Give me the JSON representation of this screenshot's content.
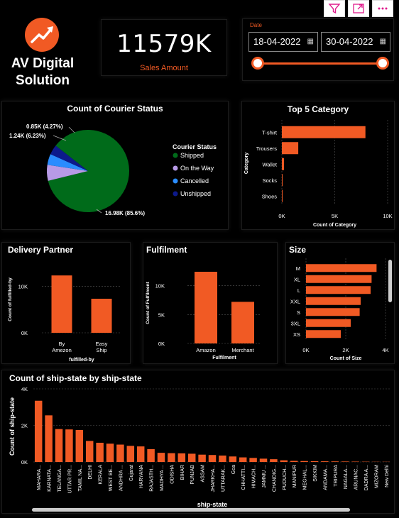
{
  "brand": {
    "name_line1": "AV Digital",
    "name_line2": "Solution"
  },
  "toolbar": {
    "filter_icon": "filter-icon",
    "focus_icon": "focus-mode-icon",
    "more_icon": "more-options-icon"
  },
  "kpi": {
    "value": "11579K",
    "label": "Sales Amount"
  },
  "date_slicer": {
    "label": "Date",
    "start": "18-04-2022",
    "end": "30-04-2022",
    "accent": "#f15a24"
  },
  "colors": {
    "bar": "#f15a24",
    "background": "#000000",
    "grid": "#555555"
  },
  "chart_data": [
    {
      "id": "courier",
      "type": "pie",
      "title": "Count of Courier Status",
      "legend_title": "Courier Status",
      "legend_position": "right",
      "slices": [
        {
          "name": "Shipped",
          "value": 16.98,
          "label": "16.98K (85.6%)",
          "color": "#006b1a"
        },
        {
          "name": "On the Way",
          "value": 1.24,
          "label": "1.24K (6.23%)",
          "color": "#b79ae6"
        },
        {
          "name": "Cancelled",
          "value": 0.85,
          "label": "0.85K (4.27%)",
          "color": "#2a8cff"
        },
        {
          "name": "Unshipped",
          "value": 0.77,
          "label": "",
          "color": "#0d1a8c"
        }
      ]
    },
    {
      "id": "category",
      "type": "bar",
      "orientation": "horizontal",
      "title": "Top 5 Category",
      "categories": [
        "T-shirt",
        "Trousers",
        "Wallet",
        "Socks",
        "Shoes"
      ],
      "values": [
        7900,
        1550,
        200,
        30,
        20
      ],
      "xlim": [
        0,
        10000
      ],
      "ticks": [
        0,
        5000,
        10000
      ],
      "tick_labels": [
        "0K",
        "5K",
        "10K"
      ],
      "xlabel": "Count of Category",
      "ylabel": "Category",
      "grid": true
    },
    {
      "id": "partner",
      "type": "bar",
      "title": "Delivery Partner",
      "categories": [
        "By Amezon",
        "Easy Ship"
      ],
      "category_lines": [
        [
          "By",
          "Amezon"
        ],
        [
          "Easy",
          "Ship"
        ]
      ],
      "values": [
        12300,
        7300
      ],
      "ylim": [
        0,
        14000
      ],
      "ticks": [
        0,
        10000
      ],
      "tick_labels": [
        "0K",
        "10K"
      ],
      "xlabel": "fulfilled-by",
      "ylabel": "Count of fulfilled-by",
      "grid": true
    },
    {
      "id": "fulfilment",
      "type": "bar",
      "title": "Fulfilment",
      "categories": [
        "Amazon",
        "Merchant"
      ],
      "values": [
        12400,
        7200
      ],
      "ylim": [
        0,
        14000
      ],
      "ticks": [
        0,
        5000,
        10000
      ],
      "tick_labels": [
        "0K",
        "5K",
        "10K"
      ],
      "xlabel": "Fulfilment",
      "ylabel": "Count of Fulfilment",
      "grid": true
    },
    {
      "id": "size",
      "type": "bar",
      "orientation": "horizontal",
      "title": "Size",
      "categories": [
        "M",
        "XL",
        "L",
        "XXL",
        "S",
        "3XL",
        "XS"
      ],
      "values": [
        3550,
        3300,
        3250,
        2750,
        2700,
        2250,
        1750
      ],
      "xlim": [
        0,
        4000
      ],
      "ticks": [
        0,
        2000,
        4000
      ],
      "tick_labels": [
        "0K",
        "2K",
        "4K"
      ],
      "xlabel": "Count of Size",
      "grid": true
    },
    {
      "id": "state",
      "type": "bar",
      "title": "Count of ship-state by ship-state",
      "categories": [
        "MAHARA...",
        "KARNATA...",
        "TELANGA...",
        "UTTAR PR...",
        "TAMIL NA...",
        "DELHI",
        "KERALA",
        "WEST BE...",
        "ANDHRA ...",
        "Gujarat",
        "HARYANA",
        "RAJASTH...",
        "MADHYA ...",
        "ODISHA",
        "BIHAR",
        "PUNJAB",
        "ASSAM",
        "JHARKHA...",
        "UTTARAK...",
        "Goa",
        "CHHATTI...",
        "HIMACH...",
        "JAMMU ...",
        "CHANDIG...",
        "PUDUCH...",
        "MANIPUR",
        "MEGHAL...",
        "SIKKIM",
        "ANDAMA...",
        "TRIPURA",
        "NAGALA...",
        "ARUNAC...",
        "DADRA A...",
        "MIZORAM",
        "New Delhi"
      ],
      "values": [
        3350,
        2550,
        1800,
        1780,
        1750,
        1150,
        1050,
        1000,
        950,
        880,
        850,
        700,
        500,
        480,
        470,
        450,
        400,
        380,
        350,
        300,
        250,
        220,
        180,
        150,
        90,
        60,
        50,
        40,
        35,
        30,
        25,
        20,
        15,
        10,
        10
      ],
      "ylim": [
        0,
        4000
      ],
      "ticks": [
        0,
        2000,
        4000
      ],
      "tick_labels": [
        "0K",
        "2K",
        "4K"
      ],
      "xlabel": "ship-state",
      "ylabel": "Count of ship-state",
      "grid": true
    }
  ]
}
